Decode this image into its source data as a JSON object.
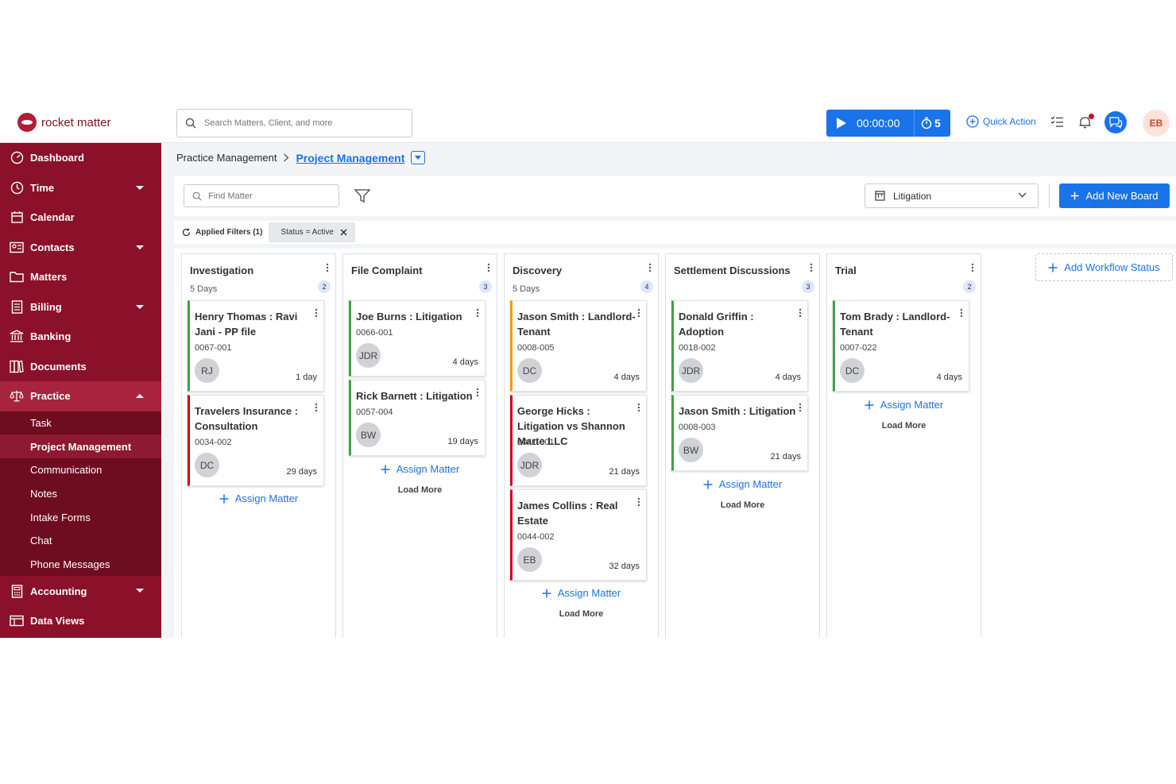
{
  "brand": {
    "name": "rocket matter"
  },
  "search": {
    "placeholder": "Search Matters, Client, and more"
  },
  "timer": {
    "time": "00:00:00",
    "count": "5"
  },
  "header": {
    "quick_action": "Quick Action",
    "avatar_initials": "EB"
  },
  "sidebar": {
    "items": [
      {
        "label": "Dashboard",
        "icon": "dashboard-icon"
      },
      {
        "label": "Time",
        "icon": "clock-icon"
      },
      {
        "label": "Calendar",
        "icon": "calendar-icon"
      },
      {
        "label": "Contacts",
        "icon": "contacts-icon"
      },
      {
        "label": "Matters",
        "icon": "folder-icon"
      },
      {
        "label": "Billing",
        "icon": "billing-icon"
      },
      {
        "label": "Banking",
        "icon": "bank-icon"
      },
      {
        "label": "Documents",
        "icon": "documents-icon"
      },
      {
        "label": "Practice",
        "icon": "scales-icon"
      },
      {
        "label": "Accounting",
        "icon": "accounting-icon"
      },
      {
        "label": "Data Views",
        "icon": "data-views-icon"
      }
    ],
    "practice_sub": [
      "Task",
      "Project Management",
      "Communication",
      "Notes",
      "Intake Forms",
      "Chat",
      "Phone Messages"
    ]
  },
  "breadcrumb": {
    "parent": "Practice Management",
    "current": "Project Management"
  },
  "toolbar": {
    "find_placeholder": "Find Matter",
    "board_selected": "Litigation",
    "add_board": "Add New Board"
  },
  "filters": {
    "applied": "Applied Filters (1)",
    "chip": "Status = Active"
  },
  "board": {
    "assign_label": "Assign Matter",
    "load_more": "Load More",
    "add_status": "Add Workflow Status",
    "columns": [
      {
        "title": "Investigation",
        "sub": "5 Days",
        "count": "2",
        "cards": [
          {
            "title": "Henry Thomas : Ravi Jani - PP file",
            "id": "0067-001",
            "initials": "RJ",
            "days": "1 day"
          },
          {
            "title": "Travelers Insurance : Consultation",
            "id": "0034-002",
            "initials": "DC",
            "days": "29 days"
          }
        ]
      },
      {
        "title": "File Complaint",
        "sub": "",
        "count": "3",
        "cards": [
          {
            "title": "Joe Burns : Litigation",
            "id": "0066-001",
            "initials": "JDR",
            "days": "4 days"
          },
          {
            "title": "Rick Barnett : Litigation",
            "id": "0057-004",
            "initials": "BW",
            "days": "19 days"
          }
        ]
      },
      {
        "title": "Discovery",
        "sub": "5 Days",
        "count": "4",
        "cards": [
          {
            "title": "Jason Smith : Landlord-Tenant",
            "id": "0008-005",
            "initials": "DC",
            "days": "4 days"
          },
          {
            "title": "George Hicks : Litigation vs Shannon Marte LLC",
            "id": "0041-001",
            "initials": "JDR",
            "days": "21 days"
          },
          {
            "title": "James Collins : Real Estate",
            "id": "0044-002",
            "initials": "EB",
            "days": "32 days"
          }
        ]
      },
      {
        "title": "Settlement Discussions",
        "sub": "",
        "count": "3",
        "cards": [
          {
            "title": "Donald Griffin : Adoption",
            "id": "0018-002",
            "initials": "JDR",
            "days": "4 days"
          },
          {
            "title": "Jason Smith : Litigation",
            "id": "0008-003",
            "initials": "BW",
            "days": "21 days"
          }
        ]
      },
      {
        "title": "Trial",
        "sub": "",
        "count": "2",
        "cards": [
          {
            "title": "Tom Brady : Landlord-Tenant",
            "id": "0007-022",
            "initials": "DC",
            "days": "4 days"
          }
        ]
      }
    ]
  }
}
